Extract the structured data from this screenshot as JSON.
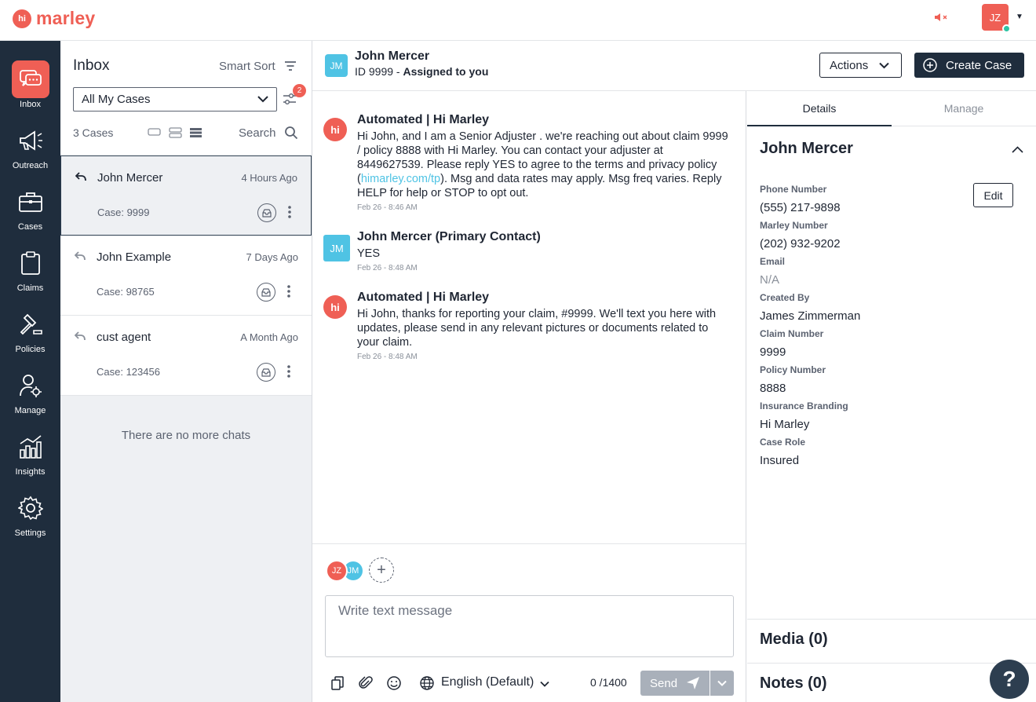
{
  "app": {
    "logo_badge": "hi",
    "logo_text": "marley",
    "user_initials": "JZ",
    "brand_color": "#ef5f55",
    "nav_color": "#1f2d3d"
  },
  "sidenav": [
    {
      "label": "Inbox",
      "icon": "chat-bubbles-icon"
    },
    {
      "label": "Outreach",
      "icon": "megaphone-icon"
    },
    {
      "label": "Cases",
      "icon": "briefcase-icon"
    },
    {
      "label": "Claims",
      "icon": "clipboard-icon"
    },
    {
      "label": "Policies",
      "icon": "gavel-icon"
    },
    {
      "label": "Manage",
      "icon": "user-gear-icon"
    },
    {
      "label": "Insights",
      "icon": "bar-chart-icon"
    },
    {
      "label": "Settings",
      "icon": "gear-icon"
    }
  ],
  "inbox": {
    "title": "Inbox",
    "sort_label": "Smart Sort",
    "filter_value": "All My Cases",
    "filter_badge": "2",
    "cases_count": "3 Cases",
    "search_label": "Search",
    "cases": [
      {
        "name": "John Mercer",
        "time": "4 Hours Ago",
        "case": "Case: 9999"
      },
      {
        "name": "John Example",
        "time": "7 Days Ago",
        "case": "Case: 98765"
      },
      {
        "name": "cust agent",
        "time": "A Month Ago",
        "case": "Case: 123456"
      }
    ],
    "empty_text": "There are no more chats"
  },
  "chat": {
    "avatar": "JM",
    "name": "John Mercer",
    "id_text": "ID 9999 -",
    "assigned": "Assigned to you",
    "actions_label": "Actions",
    "create_label": "Create Case",
    "messages": [
      {
        "avatar": "hi",
        "sender": "Automated | Hi Marley",
        "body_before": "Hi John, and I am a Senior Adjuster . we're reaching out about claim 9999 / policy 8888 with Hi Marley. You can contact your adjuster at 8449627539. Please reply YES to agree to the terms and privacy policy (",
        "link": "himarley.com/tp",
        "body_after": "). Msg and data rates may apply. Msg freq varies. Reply HELP for help or STOP to opt out.",
        "time": "Feb 26 - 8:46 AM"
      },
      {
        "avatar": "JM",
        "sender": "John Mercer (Primary Contact)",
        "body": "YES",
        "time": "Feb 26 - 8:48 AM"
      },
      {
        "avatar": "hi",
        "sender": "Automated | Hi Marley",
        "body": "Hi John, thanks for reporting your claim, #9999. We'll text you here with updates, please send in any relevant pictures or documents related to your claim.",
        "time": "Feb 26 - 8:48 AM"
      }
    ],
    "participants": [
      "JZ",
      "JM"
    ],
    "placeholder": "Write text message",
    "language": "English (Default)",
    "char_count": "0 /1400",
    "send_label": "Send"
  },
  "details": {
    "tabs": [
      "Details",
      "Manage"
    ],
    "name": "John Mercer",
    "edit_label": "Edit",
    "fields": [
      {
        "label": "Phone Number",
        "value": "(555) 217-9898"
      },
      {
        "label": "Marley Number",
        "value": "(202) 932-9202"
      },
      {
        "label": "Email",
        "value": "N/A"
      },
      {
        "label": "Created By",
        "value": "James Zimmerman"
      },
      {
        "label": "Claim Number",
        "value": "9999"
      },
      {
        "label": "Policy Number",
        "value": "8888"
      },
      {
        "label": "Insurance Branding",
        "value": "Hi Marley"
      },
      {
        "label": "Case Role",
        "value": "Insured"
      }
    ],
    "media": "Media (0)",
    "notes": "Notes (0)"
  },
  "help_label": "?"
}
